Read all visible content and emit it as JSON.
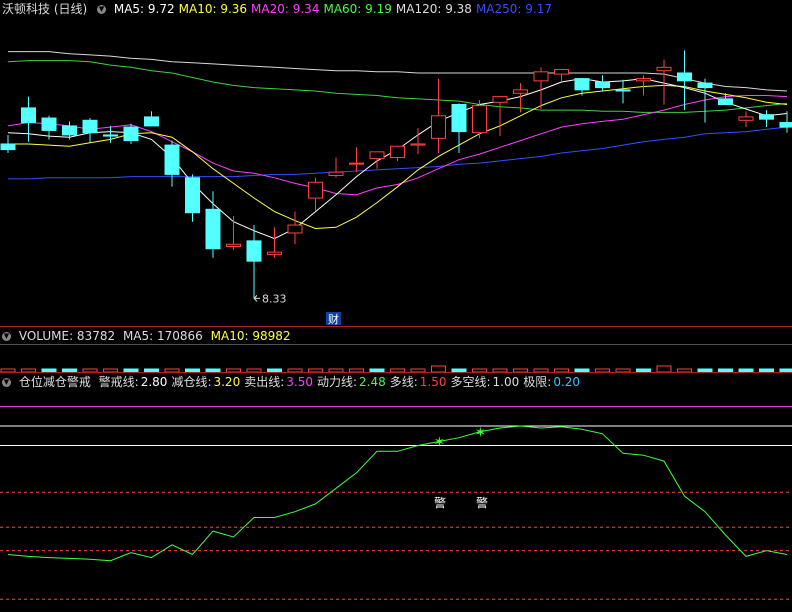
{
  "main_panel": {
    "title": "沃顿科技 (日线)",
    "indicators": [
      {
        "label": "MA5: 9.72",
        "color": "#ffffff"
      },
      {
        "label": "MA10: 9.36",
        "color": "#ffff40"
      },
      {
        "label": "MA20: 9.34",
        "color": "#ff40ff"
      },
      {
        "label": "MA60: 9.19",
        "color": "#40ff40"
      },
      {
        "label": "MA120: 9.38",
        "color": "#dddddd"
      },
      {
        "label": "MA250: 9.17",
        "color": "#3050ff"
      }
    ],
    "low_label": "8.33",
    "fin_badge": "财"
  },
  "volume_panel": {
    "title": "VOLUME: 83782",
    "ma5": "MA5: 170866",
    "ma10": "MA10: 98982"
  },
  "indicator_panel": {
    "title": "仓位减仓警戒",
    "params": [
      {
        "label": "警戒线:",
        "value": "2.80",
        "color": "#ffffff"
      },
      {
        "label": "减仓线:",
        "value": "3.20",
        "color": "#ffff40"
      },
      {
        "label": "卖出线:",
        "value": "3.50",
        "color": "#ff40ff"
      },
      {
        "label": "动力线:",
        "value": "2.48",
        "color": "#40ff40"
      },
      {
        "label": "多线:",
        "value": "1.50",
        "color": "#ff4040"
      },
      {
        "label": "多空线:",
        "value": "1.00",
        "color": "#dddddd"
      },
      {
        "label": "极限:",
        "value": "0.20",
        "color": "#40c0ff"
      }
    ],
    "warnings": [
      "警",
      "警"
    ]
  },
  "colors": {
    "up": "#ff4040",
    "down": "#54ffff",
    "bg": "#000000",
    "separator": "#b02020"
  },
  "chart_data": {
    "type": "candlestick",
    "candles": [
      [
        9.7,
        9.78,
        9.65,
        9.62
      ],
      [
        10.02,
        10.12,
        9.89,
        9.72
      ],
      [
        9.93,
        9.95,
        9.82,
        9.74
      ],
      [
        9.86,
        9.9,
        9.78,
        9.74
      ],
      [
        9.91,
        9.93,
        9.8,
        9.71
      ],
      [
        9.78,
        9.86,
        9.77,
        9.71
      ],
      [
        9.85,
        9.88,
        9.73,
        9.7
      ],
      [
        9.94,
        9.99,
        9.86,
        9.9
      ],
      [
        9.69,
        9.73,
        9.43,
        9.32
      ],
      [
        9.4,
        9.43,
        9.09,
        9.01
      ],
      [
        9.12,
        9.28,
        8.77,
        8.69
      ],
      [
        8.79,
        9.06,
        8.81,
        8.76
      ],
      [
        8.84,
        8.98,
        8.66,
        8.33
      ],
      [
        8.72,
        8.96,
        8.74,
        8.69
      ],
      [
        8.91,
        9.1,
        8.98,
        8.81
      ],
      [
        9.22,
        9.4,
        9.36,
        9.11
      ],
      [
        9.42,
        9.58,
        9.45,
        9.4
      ],
      [
        9.53,
        9.67,
        9.53,
        9.45
      ],
      [
        9.57,
        9.6,
        9.63,
        9.48
      ],
      [
        9.58,
        9.65,
        9.68,
        9.55
      ],
      [
        9.69,
        9.84,
        9.7,
        9.61
      ],
      [
        9.75,
        10.28,
        9.95,
        9.62
      ],
      [
        10.05,
        10.06,
        9.81,
        9.62
      ],
      [
        9.8,
        10.09,
        10.04,
        9.75
      ],
      [
        10.07,
        10.11,
        10.12,
        9.77
      ],
      [
        10.15,
        10.24,
        10.18,
        9.98
      ],
      [
        10.26,
        10.38,
        10.34,
        10.01
      ],
      [
        10.32,
        10.34,
        10.36,
        10.26
      ],
      [
        10.28,
        10.27,
        10.18,
        10.13
      ],
      [
        10.25,
        10.31,
        10.2,
        10.17
      ],
      [
        10.18,
        10.27,
        10.17,
        10.06
      ],
      [
        10.26,
        10.31,
        10.28,
        10.13
      ],
      [
        10.35,
        10.45,
        10.38,
        10.05
      ],
      [
        10.33,
        10.53,
        10.26,
        10.0
      ],
      [
        10.24,
        10.28,
        10.2,
        9.89
      ],
      [
        10.1,
        10.15,
        10.05,
        10.05
      ],
      [
        9.91,
        9.99,
        9.94,
        9.85
      ],
      [
        9.96,
        10.0,
        9.92,
        9.85
      ],
      [
        9.89,
        9.99,
        9.85,
        9.8
      ]
    ],
    "ma5": [
      9.8,
      9.79,
      9.77,
      9.76,
      9.8,
      9.81,
      9.8,
      9.74,
      9.58,
      9.35,
      9.17,
      9.01,
      8.93,
      8.86,
      8.95,
      9.1,
      9.25,
      9.41,
      9.55,
      9.65,
      9.78,
      9.9,
      9.98,
      10.05,
      10.08,
      10.12,
      10.18,
      10.25,
      10.28,
      10.25,
      10.26,
      10.28,
      10.24,
      10.2,
      10.15,
      10.07,
      10.01,
      9.95,
      9.97
    ],
    "ma10": [
      9.7,
      9.7,
      9.69,
      9.68,
      9.71,
      9.74,
      9.79,
      9.8,
      9.76,
      9.63,
      9.48,
      9.35,
      9.22,
      9.1,
      9.02,
      8.95,
      8.96,
      9.05,
      9.18,
      9.32,
      9.47,
      9.59,
      9.69,
      9.79,
      9.86,
      9.95,
      10.04,
      10.11,
      10.15,
      10.17,
      10.19,
      10.21,
      10.22,
      10.21,
      10.17,
      10.14,
      10.11,
      10.07,
      10.05
    ],
    "ma20": [
      9.86,
      9.89,
      9.88,
      9.86,
      9.83,
      9.85,
      9.87,
      9.81,
      9.72,
      9.63,
      9.53,
      9.46,
      9.44,
      9.4,
      9.35,
      9.31,
      9.26,
      9.25,
      9.31,
      9.34,
      9.4,
      9.48,
      9.56,
      9.61,
      9.67,
      9.73,
      9.79,
      9.85,
      9.88,
      9.9,
      9.92,
      9.96,
      10.0,
      10.05,
      10.09,
      10.12,
      10.13,
      10.13,
      10.12
    ],
    "ma60": [
      10.43,
      10.44,
      10.44,
      10.44,
      10.43,
      10.4,
      10.38,
      10.35,
      10.33,
      10.29,
      10.25,
      10.22,
      10.2,
      10.19,
      10.18,
      10.17,
      10.15,
      10.14,
      10.13,
      10.11,
      10.1,
      10.09,
      10.08,
      10.05,
      10.03,
      10.02,
      10.0,
      10.0,
      10.0,
      9.99,
      9.99,
      9.98,
      9.98,
      9.98,
      9.99,
      10.0,
      10.02,
      10.04,
      10.06
    ],
    "ma120": [
      10.52,
      10.52,
      10.52,
      10.5,
      10.49,
      10.48,
      10.46,
      10.45,
      10.43,
      10.42,
      10.41,
      10.4,
      10.39,
      10.38,
      10.37,
      10.36,
      10.35,
      10.35,
      10.34,
      10.34,
      10.33,
      10.33,
      10.33,
      10.33,
      10.33,
      10.33,
      10.33,
      10.33,
      10.33,
      10.33,
      10.33,
      10.33,
      10.32,
      10.28,
      10.24,
      10.21,
      10.2,
      10.18,
      10.17
    ],
    "ma250": [
      9.39,
      9.39,
      9.4,
      9.4,
      9.4,
      9.4,
      9.41,
      9.41,
      9.41,
      9.41,
      9.41,
      9.41,
      9.42,
      9.43,
      9.43,
      9.44,
      9.45,
      9.46,
      9.47,
      9.48,
      9.49,
      9.5,
      9.52,
      9.53,
      9.55,
      9.57,
      9.59,
      9.62,
      9.64,
      9.66,
      9.69,
      9.72,
      9.74,
      9.76,
      9.79,
      9.8,
      9.81,
      9.83,
      9.85
    ],
    "volume_up": [
      1,
      1,
      0,
      0,
      1,
      1,
      0,
      0,
      1,
      0,
      0,
      1,
      1,
      0,
      1,
      1,
      1,
      1,
      0,
      1,
      1,
      1,
      0,
      1,
      1,
      1,
      1,
      1,
      0,
      1,
      1,
      0,
      1,
      1,
      0,
      0,
      0,
      0,
      0
    ],
    "power_line": [
      1.7,
      1.65,
      1.62,
      1.6,
      1.58,
      1.54,
      1.75,
      1.62,
      1.95,
      1.7,
      2.3,
      2.15,
      2.65,
      2.65,
      2.8,
      3.0,
      3.4,
      3.8,
      4.35,
      4.35,
      4.5,
      4.6,
      4.7,
      4.85,
      4.95,
      5.0,
      4.95,
      4.98,
      4.92,
      4.8,
      4.3,
      4.25,
      4.1,
      3.2,
      2.8,
      2.2,
      1.65,
      1.8,
      1.7
    ],
    "levels": {
      "警戒线": 2.8,
      "减仓线": 3.2,
      "卖出线": 3.5,
      "动力线": 2.48,
      "多线": 1.5,
      "多空线": 1.0,
      "极限": 0.2
    }
  }
}
